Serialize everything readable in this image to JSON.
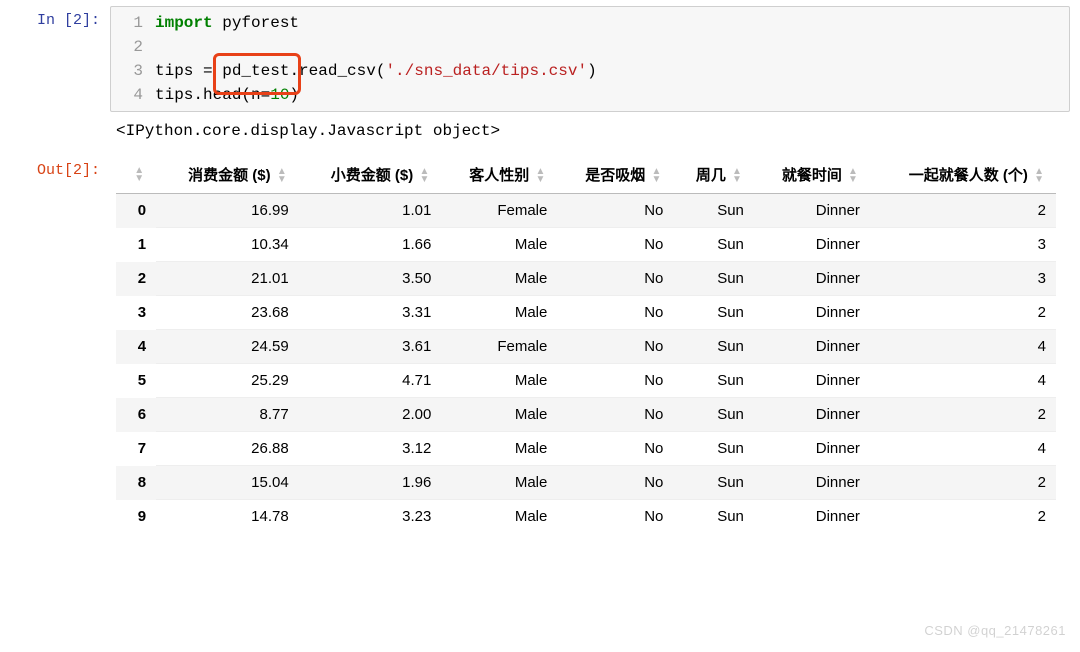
{
  "input_prompt": "In [2]:",
  "output_prompt": "Out[2]:",
  "code": {
    "line1_gutter": "1",
    "line1_kw": "import",
    "line1_mod": " pyforest",
    "line2_gutter": "2",
    "line3_gutter": "3",
    "line3_pre": "tips = ",
    "line3_hl": "pd_test",
    "line3_mid": ".read_csv(",
    "line3_str": "'./sns_data/tips.csv'",
    "line3_post": ")",
    "line4_gutter": "4",
    "line4_pre": "tips.head(n=",
    "line4_num": "10",
    "line4_post": ")"
  },
  "text_output": "<IPython.core.display.Javascript object>",
  "watermark": "CSDN @qq_21478261",
  "chart_data": {
    "type": "table",
    "columns": [
      "",
      "消费金额 ($)",
      "小费金额 ($)",
      "客人性别",
      "是否吸烟",
      "周几",
      "就餐时间",
      "一起就餐人数 (个)"
    ],
    "rows": [
      {
        "idx": "0",
        "bill": "16.99",
        "tip": "1.01",
        "sex": "Female",
        "smoker": "No",
        "day": "Sun",
        "time": "Dinner",
        "size": "2"
      },
      {
        "idx": "1",
        "bill": "10.34",
        "tip": "1.66",
        "sex": "Male",
        "smoker": "No",
        "day": "Sun",
        "time": "Dinner",
        "size": "3"
      },
      {
        "idx": "2",
        "bill": "21.01",
        "tip": "3.50",
        "sex": "Male",
        "smoker": "No",
        "day": "Sun",
        "time": "Dinner",
        "size": "3"
      },
      {
        "idx": "3",
        "bill": "23.68",
        "tip": "3.31",
        "sex": "Male",
        "smoker": "No",
        "day": "Sun",
        "time": "Dinner",
        "size": "2"
      },
      {
        "idx": "4",
        "bill": "24.59",
        "tip": "3.61",
        "sex": "Female",
        "smoker": "No",
        "day": "Sun",
        "time": "Dinner",
        "size": "4"
      },
      {
        "idx": "5",
        "bill": "25.29",
        "tip": "4.71",
        "sex": "Male",
        "smoker": "No",
        "day": "Sun",
        "time": "Dinner",
        "size": "4"
      },
      {
        "idx": "6",
        "bill": "8.77",
        "tip": "2.00",
        "sex": "Male",
        "smoker": "No",
        "day": "Sun",
        "time": "Dinner",
        "size": "2"
      },
      {
        "idx": "7",
        "bill": "26.88",
        "tip": "3.12",
        "sex": "Male",
        "smoker": "No",
        "day": "Sun",
        "time": "Dinner",
        "size": "4"
      },
      {
        "idx": "8",
        "bill": "15.04",
        "tip": "1.96",
        "sex": "Male",
        "smoker": "No",
        "day": "Sun",
        "time": "Dinner",
        "size": "2"
      },
      {
        "idx": "9",
        "bill": "14.78",
        "tip": "3.23",
        "sex": "Male",
        "smoker": "No",
        "day": "Sun",
        "time": "Dinner",
        "size": "2"
      }
    ]
  }
}
